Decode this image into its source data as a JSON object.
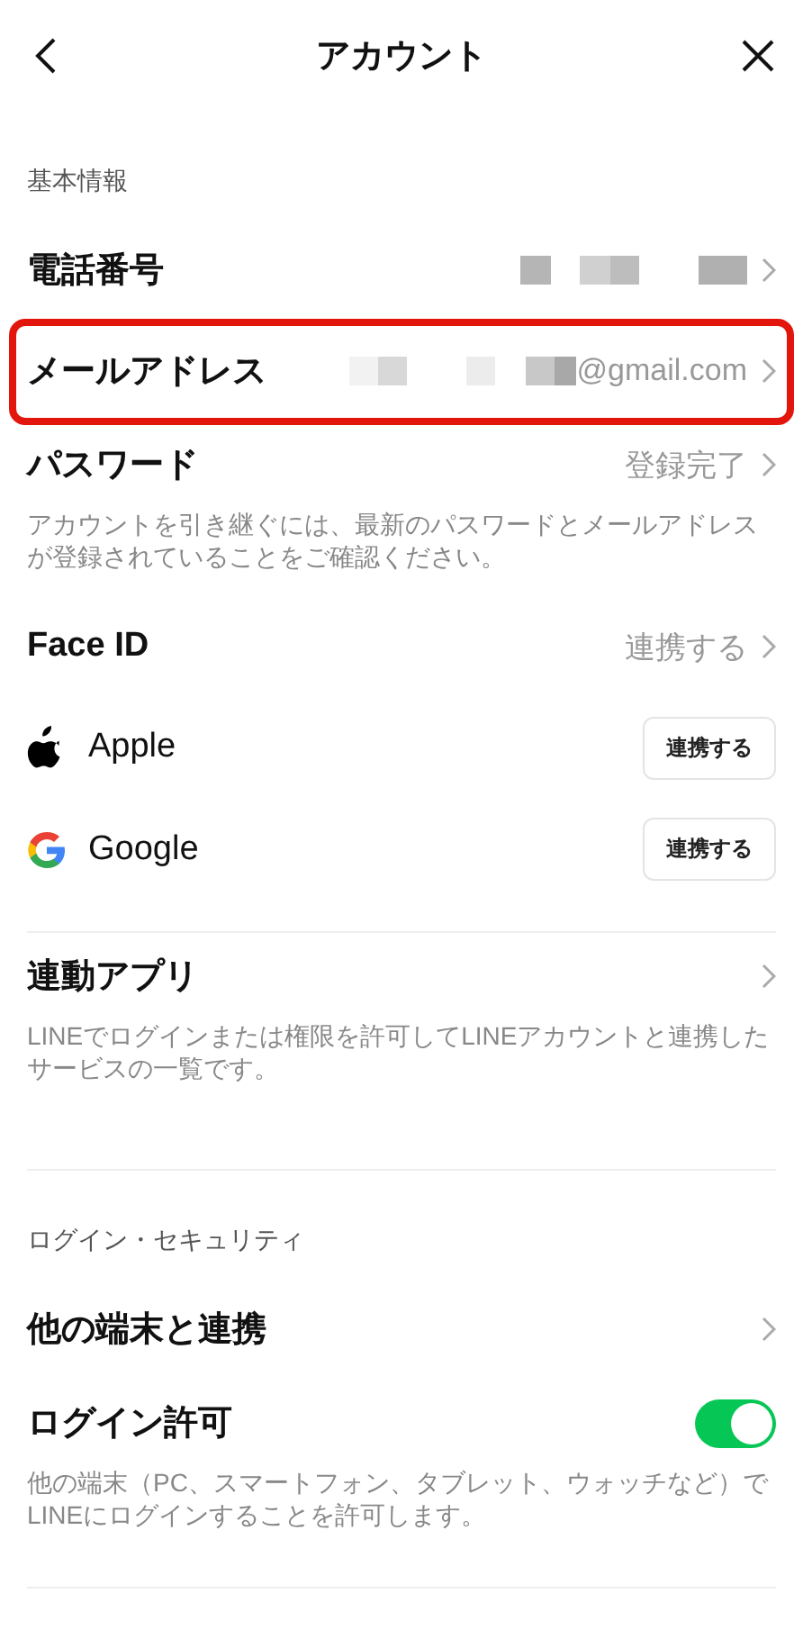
{
  "header": {
    "title": "アカウント"
  },
  "items": [
    {
      "kind": "section",
      "label": "基本情報"
    },
    {
      "kind": "nav",
      "label": "電話番号",
      "masked": true,
      "highlighted": false
    },
    {
      "kind": "nav",
      "label": "メールアドレス",
      "masked": true,
      "value": "@gmail.com",
      "highlighted": true
    },
    {
      "kind": "nav",
      "label": "パスワード",
      "value": "登録完了",
      "note": "アカウントを引き継ぐには、最新のパスワードとメールアドレスが登録されていることをご確認ください。",
      "highlighted": false
    },
    {
      "kind": "nav",
      "label": "Face ID",
      "value": "連携する",
      "highlighted": false
    },
    {
      "kind": "apple",
      "label": "Apple",
      "button": "連携する"
    },
    {
      "kind": "google",
      "label": "Google",
      "button": "連携する"
    },
    {
      "kind": "divider"
    },
    {
      "kind": "nav",
      "label": "連動アプリ",
      "note": "LINEでログインまたは権限を許可してLINEアカウントと連携したサービスの一覧です。",
      "highlighted": false
    },
    {
      "kind": "divider"
    },
    {
      "kind": "section",
      "label": "ログイン・セキュリティ"
    },
    {
      "kind": "nav",
      "label": "他の端末と連携",
      "highlighted": false
    },
    {
      "kind": "toggle",
      "label": "ログイン許可",
      "on": true,
      "note": "他の端末（PC、スマートフォン、タブレット、ウォッチなど）でLINEにログインすることを許可します。"
    },
    {
      "kind": "divider"
    }
  ]
}
